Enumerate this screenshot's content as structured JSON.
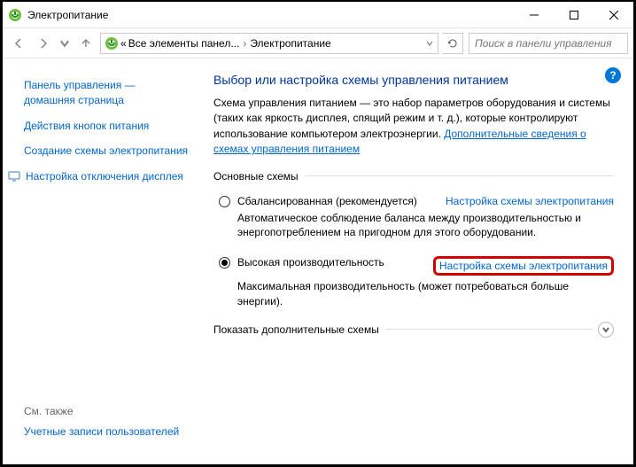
{
  "window": {
    "title": "Электропитание"
  },
  "toolbar": {
    "breadcrumb": {
      "prefix": "«",
      "part1": "Все элементы панел...",
      "part2": "Электропитание"
    },
    "search_placeholder": "Поиск в панели управления"
  },
  "sidebar": {
    "home": "Панель управления — домашняя страница",
    "actions": "Действия кнопок питания",
    "create": "Создание схемы электропитания",
    "display": "Настройка отключения дисплея",
    "see_also": "См. также",
    "accounts": "Учетные записи пользователей"
  },
  "main": {
    "heading": "Выбор или настройка схемы управления питанием",
    "desc_pre": "Схема управления питанием — это набор параметров оборудования и системы (таких как яркость дисплея, спящий режим и т. д.), которые контролируют использование компьютером электроэнергии. ",
    "desc_link": "Дополнительные сведения о схемах управления питанием",
    "section_default": "Основные схемы",
    "plan1": {
      "name": "Сбалансированная (рекомендуется)",
      "settings": "Настройка схемы электропитания",
      "desc": "Автоматическое соблюдение баланса между производительностью и энергопотреблением на пригодном для этого оборудовании."
    },
    "plan2": {
      "name": "Высокая производительность",
      "settings": "Настройка схемы электропитания",
      "desc": "Максимальная производительность (может потребоваться больше энергии)."
    },
    "section_more": "Показать дополнительные схемы"
  },
  "help": "?"
}
